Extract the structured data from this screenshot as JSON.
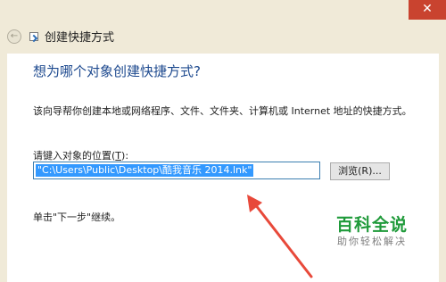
{
  "window": {
    "title": "创建快捷方式",
    "close_glyph": "✕",
    "back_glyph": "←"
  },
  "main": {
    "heading": "想为哪个对象创建快捷方式?",
    "description": "该向导帮你创建本地或网络程序、文件、文件夹、计算机或 Internet 地址的快捷方式。",
    "location_label_prefix": "请键入对象的位置(",
    "location_label_key": "T",
    "location_label_suffix": "):",
    "location_value": "\"C:\\Users\\Public\\Desktop\\酷我音乐 2014.lnk\"",
    "browse_label": "浏览(R)...",
    "instruction": "单击\"下一步\"继续。"
  },
  "watermark": {
    "title": "百科全说",
    "subtitle": "助你轻松解决"
  },
  "colors": {
    "heading": "#1e4a8f",
    "selection": "#3399ff",
    "arrow": "#e8493a",
    "watermark": "#1f9a3a"
  }
}
